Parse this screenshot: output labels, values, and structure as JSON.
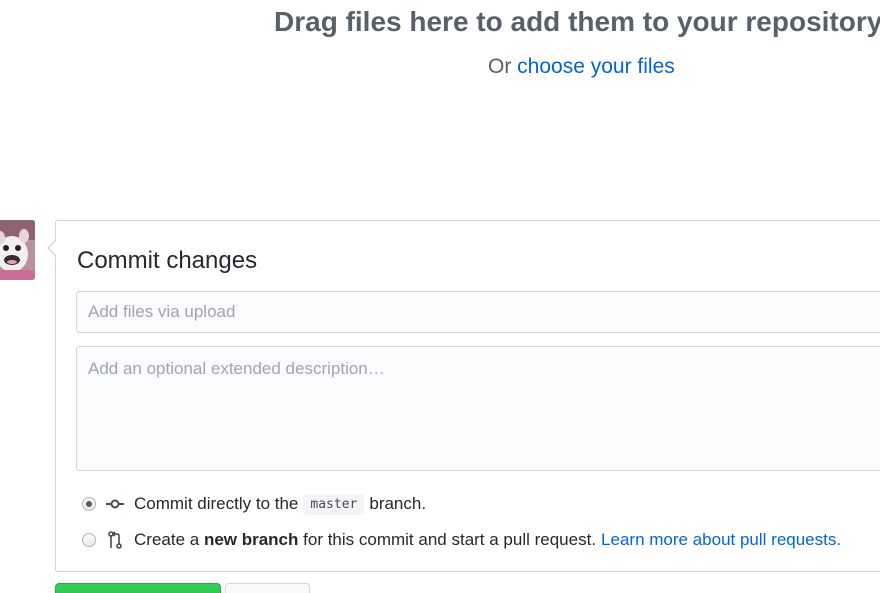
{
  "dropzone": {
    "title": "Drag files here to add them to your repository",
    "or_text": "Or",
    "choose_link": "choose your files"
  },
  "commit": {
    "heading": "Commit changes",
    "summary_placeholder": "Add files via upload",
    "description_placeholder": "Add an optional extended description…",
    "option_direct": {
      "prefix": "Commit directly to the",
      "branch": "master",
      "suffix": "branch.",
      "selected": true
    },
    "option_new_branch": {
      "prefix": "Create a",
      "bold": "new branch",
      "middle": "for this commit and start a pull request.",
      "link": "Learn more about pull requests.",
      "selected": false
    }
  },
  "icons": {
    "commit": "git-commit-icon",
    "pull_request": "git-pull-request-icon",
    "avatar": "user-avatar"
  },
  "colors": {
    "link": "#0366d6",
    "heading_muted": "#586069",
    "primary_button": "#28a745",
    "border": "#d1d5da"
  }
}
